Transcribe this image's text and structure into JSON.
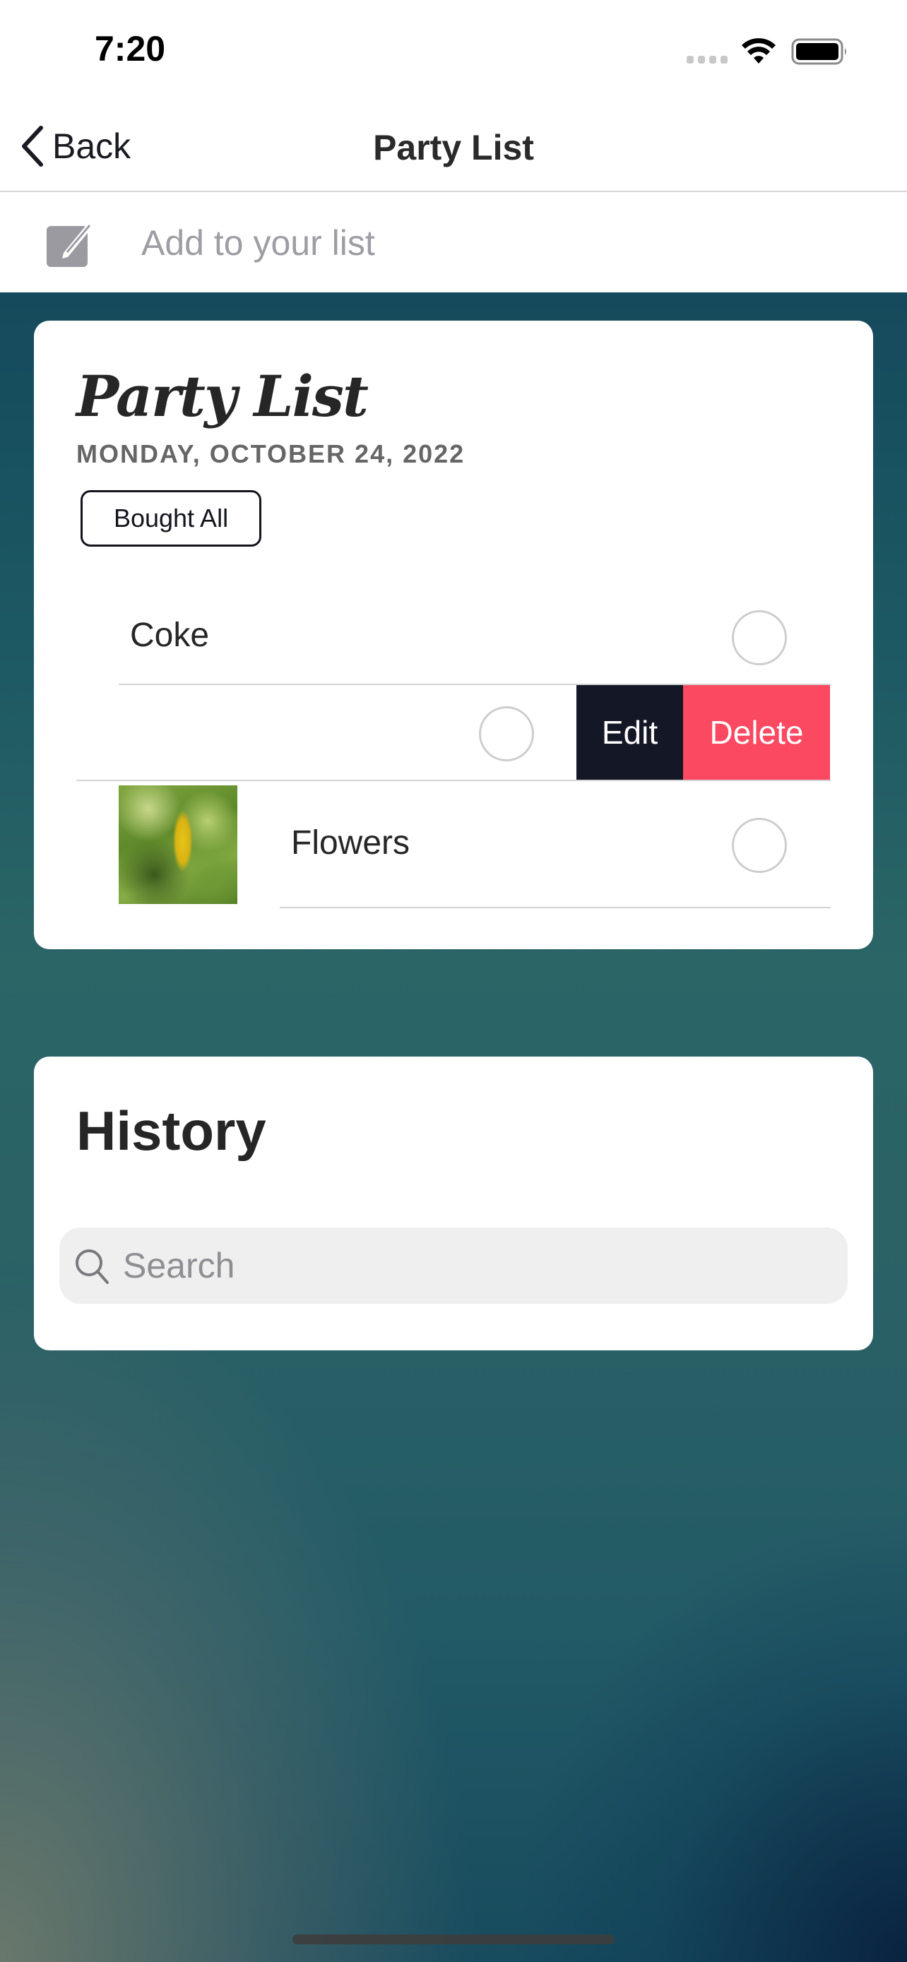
{
  "status_bar": {
    "time": "7:20",
    "icons": [
      "cellular-signal-icon",
      "wifi-icon",
      "battery-icon"
    ]
  },
  "nav": {
    "back_label": "Back",
    "title": "Party List"
  },
  "add_bar": {
    "icon": "compose-icon",
    "placeholder": "Add to your list",
    "value": ""
  },
  "list": {
    "title": "Party List",
    "date": "MONDAY, OCTOBER 24, 2022",
    "bought_all_label": "Bought All",
    "items": [
      {
        "label": "Coke",
        "checked": false,
        "has_image": false
      },
      {
        "label": "",
        "checked": false,
        "has_image": false,
        "swiped": true
      },
      {
        "label": "Flowers",
        "checked": false,
        "has_image": true,
        "image_desc": "green leaves with yellow leaf"
      }
    ],
    "swipe_actions": {
      "edit_label": "Edit",
      "delete_label": "Delete",
      "edit_color": "#141826",
      "delete_color": "#fb4962"
    }
  },
  "history": {
    "title": "History",
    "search_placeholder": "Search",
    "search_value": ""
  },
  "colors": {
    "background_teal": "#1c5863",
    "card": "#ffffff",
    "text_primary": "#262626",
    "date_gray": "#666666"
  }
}
